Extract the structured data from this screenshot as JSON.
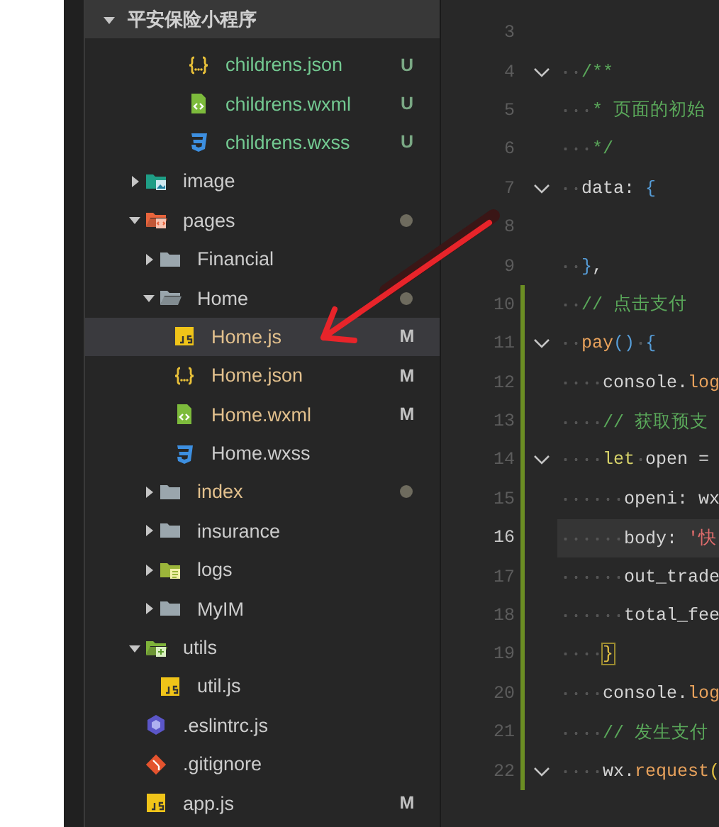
{
  "tree": {
    "title": "平安保险小程序",
    "orphan_items": [
      {
        "label": "childrens.json",
        "kind": "json",
        "color": "#73c991",
        "badge": "U",
        "changes_dot": false,
        "selected": false
      },
      {
        "label": "childrens.wxml",
        "kind": "wxml",
        "color": "#73c991",
        "badge": "U",
        "changes_dot": false,
        "selected": false
      },
      {
        "label": "childrens.wxss",
        "kind": "wxss",
        "color": "#73c991",
        "badge": "U",
        "changes_dot": false,
        "selected": false
      }
    ],
    "items": [
      {
        "label": "image",
        "kind": "image_folder",
        "color": "#cccccc",
        "expanded": false,
        "changes_dot": false,
        "selected": false
      },
      {
        "label": "pages",
        "kind": "pages_folder",
        "color": "#cccccc",
        "expanded": true,
        "changes_dot": true,
        "selected": false,
        "children": [
          {
            "label": "Financial",
            "kind": "folder",
            "color": "#cccccc",
            "expanded": false,
            "changes_dot": false,
            "selected": false
          },
          {
            "label": "Home",
            "kind": "folder",
            "color": "#cccccc",
            "expanded": true,
            "changes_dot": true,
            "selected": false,
            "children": [
              {
                "label": "Home.js",
                "kind": "js",
                "color": "#e2c08d",
                "badge": "M",
                "changes_dot": false,
                "selected": true
              },
              {
                "label": "Home.json",
                "kind": "json",
                "color": "#e2c08d",
                "badge": "M",
                "changes_dot": false,
                "selected": false
              },
              {
                "label": "Home.wxml",
                "kind": "wxml",
                "color": "#e2c08d",
                "badge": "M",
                "changes_dot": false,
                "selected": false
              },
              {
                "label": "Home.wxss",
                "kind": "wxss",
                "color": "#cccccc",
                "changes_dot": false,
                "selected": false
              }
            ]
          },
          {
            "label": "index",
            "kind": "folder",
            "color": "#e2c08d",
            "expanded": false,
            "changes_dot": true,
            "selected": false
          },
          {
            "label": "insurance",
            "kind": "folder",
            "color": "#cccccc",
            "expanded": false,
            "changes_dot": false,
            "selected": false
          },
          {
            "label": "logs",
            "kind": "logs_folder",
            "color": "#cccccc",
            "expanded": false,
            "changes_dot": false,
            "selected": false
          },
          {
            "label": "MyIM",
            "kind": "folder",
            "color": "#cccccc",
            "expanded": false,
            "changes_dot": false,
            "selected": false
          }
        ]
      },
      {
        "label": "utils",
        "kind": "utils_folder",
        "color": "#cccccc",
        "expanded": true,
        "changes_dot": false,
        "selected": false,
        "children": [
          {
            "label": "util.js",
            "kind": "js",
            "color": "#cccccc",
            "changes_dot": false,
            "selected": false
          }
        ]
      },
      {
        "label": ".eslintrc.js",
        "kind": "eslint",
        "color": "#cccccc",
        "changes_dot": false,
        "selected": false
      },
      {
        "label": ".gitignore",
        "kind": "git",
        "color": "#cccccc",
        "changes_dot": false,
        "selected": false
      },
      {
        "label": "app.js",
        "kind": "js",
        "color": "#cccccc",
        "badge": "M",
        "changes_dot": false,
        "selected": false
      }
    ]
  },
  "editor": {
    "lines": [
      {
        "number": "3",
        "fold": false,
        "changed": false,
        "current": false
      },
      {
        "number": "4",
        "fold": true,
        "changed": false,
        "current": false,
        "tokens": [
          {
            "kind": "comment",
            "text": "  /**"
          }
        ]
      },
      {
        "number": "5",
        "fold": false,
        "changed": false,
        "current": false,
        "tokens": [
          {
            "kind": "comment",
            "text": "   * 页面的初始"
          }
        ]
      },
      {
        "number": "6",
        "fold": false,
        "changed": false,
        "current": false,
        "tokens": [
          {
            "kind": "comment",
            "text": "   */"
          }
        ]
      },
      {
        "number": "7",
        "fold": true,
        "changed": false,
        "current": false,
        "tokens": [
          {
            "kind": "plain",
            "text": "  data: "
          },
          {
            "kind": "brace",
            "text": "{"
          }
        ]
      },
      {
        "number": "8",
        "fold": false,
        "changed": false,
        "current": false
      },
      {
        "number": "9",
        "fold": false,
        "changed": false,
        "current": false,
        "tokens": [
          {
            "kind": "brace",
            "text": "  }"
          },
          {
            "kind": "plain",
            "text": ","
          }
        ]
      },
      {
        "number": "10",
        "fold": false,
        "changed": true,
        "current": false,
        "tokens": [
          {
            "kind": "comment",
            "text": "  // 点击支付"
          }
        ]
      },
      {
        "number": "11",
        "fold": true,
        "changed": true,
        "current": false,
        "tokens": [
          {
            "kind": "method",
            "text": "  pay"
          },
          {
            "kind": "brace",
            "text": "()"
          },
          {
            "kind": "brace",
            "text": " {"
          }
        ]
      },
      {
        "number": "12",
        "fold": false,
        "changed": true,
        "current": false,
        "tokens": [
          {
            "kind": "plain",
            "text": "    console."
          },
          {
            "kind": "method",
            "text": "log"
          }
        ]
      },
      {
        "number": "13",
        "fold": false,
        "changed": true,
        "current": false,
        "tokens": [
          {
            "kind": "comment",
            "text": "    // 获取预支"
          }
        ]
      },
      {
        "number": "14",
        "fold": true,
        "changed": true,
        "current": false,
        "tokens": [
          {
            "kind": "keyword",
            "text": "    let"
          },
          {
            "kind": "plain",
            "text": " open ="
          }
        ]
      },
      {
        "number": "15",
        "fold": false,
        "changed": true,
        "current": false,
        "tokens": [
          {
            "kind": "plain",
            "text": "      openi: wx"
          }
        ]
      },
      {
        "number": "16",
        "fold": false,
        "changed": true,
        "current": true,
        "tokens": [
          {
            "kind": "plain",
            "text": "      body: "
          },
          {
            "kind": "string",
            "text": "'快"
          }
        ]
      },
      {
        "number": "17",
        "fold": false,
        "changed": true,
        "current": false,
        "tokens": [
          {
            "kind": "plain",
            "text": "      out_trade"
          }
        ]
      },
      {
        "number": "18",
        "fold": false,
        "changed": true,
        "current": false,
        "tokens": [
          {
            "kind": "plain",
            "text": "      total_fee"
          }
        ]
      },
      {
        "number": "19",
        "fold": false,
        "changed": true,
        "current": false,
        "tokens": [
          {
            "kind": "match",
            "text": "    }"
          }
        ]
      },
      {
        "number": "20",
        "fold": false,
        "changed": true,
        "current": false,
        "tokens": [
          {
            "kind": "plain",
            "text": "    console."
          },
          {
            "kind": "method",
            "text": "log"
          }
        ]
      },
      {
        "number": "21",
        "fold": false,
        "changed": true,
        "current": false,
        "tokens": [
          {
            "kind": "comment",
            "text": "    // 发生支付"
          }
        ]
      },
      {
        "number": "22",
        "fold": true,
        "changed": true,
        "current": false,
        "tokens": [
          {
            "kind": "plain",
            "text": "    wx."
          },
          {
            "kind": "method",
            "text": "request"
          },
          {
            "kind": "bracket",
            "text": "("
          }
        ]
      }
    ]
  }
}
